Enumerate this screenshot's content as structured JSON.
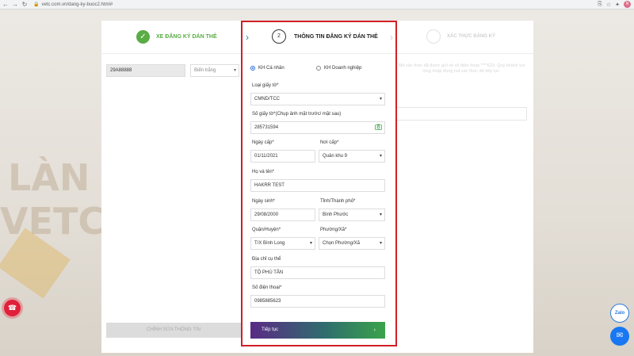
{
  "browser": {
    "url": "vetc.com.vn/dang-ky-buoc2.html#",
    "profile_initial": "N"
  },
  "background": {
    "word1": "LÀN",
    "word2": "VETC"
  },
  "steps": {
    "step1_label": "XE ĐĂNG KÝ DÁN THẺ",
    "step2_number": "2",
    "step2_label": "THÔNG TIN ĐĂNG KÝ DÁN THẺ",
    "step3_label": "XÁC THỰC ĐĂNG KÝ"
  },
  "left": {
    "plate_value": "29A88888",
    "plate_color": "Biển trắng",
    "edit_button": "CHỈNH SỬA THÔNG TIN"
  },
  "right_faded": {
    "text": "Mã xác thực đã được gửi về số điện thoại ****623. Quý khách vui lòng nhập đúng mã xác thực để tiếp tục."
  },
  "form": {
    "radio_individual": "KH Cá nhân",
    "radio_business": "KH Doanh nghiệp",
    "id_type_label": "Loại giấy tờ*",
    "id_type_value": "CMND/TCC",
    "id_number_label": "Số giấy tờ*(Chụp ảnh mặt trước/ mặt sau)",
    "id_number_value": "285731594",
    "issue_date_label": "Ngày cấp*",
    "issue_date_value": "01/11/2021",
    "issue_place_label": "Nơi cấp*",
    "issue_place_value": "Quân khu 9",
    "fullname_label": "Họ và tên*",
    "fullname_value": "HAKRR TEST",
    "dob_label": "Ngày sinh*",
    "dob_value": "29/08/2000",
    "province_label": "Tỉnh/Thành phố*",
    "province_value": "Bình Phước",
    "district_label": "Quận/Huyện*",
    "district_value": "T/X Bình Long",
    "ward_label": "Phường/Xã*",
    "ward_value": "Chọn Phường/Xã",
    "address_label": "Địa chỉ cụ thể",
    "address_value": "TỘ PHÚ TÂN",
    "phone_label": "Số điện thoại*",
    "phone_value": "0985885623",
    "next_button": "Tiếp tục",
    "next_arrow": "›"
  },
  "floating": {
    "zalo_label": "Zalo"
  }
}
